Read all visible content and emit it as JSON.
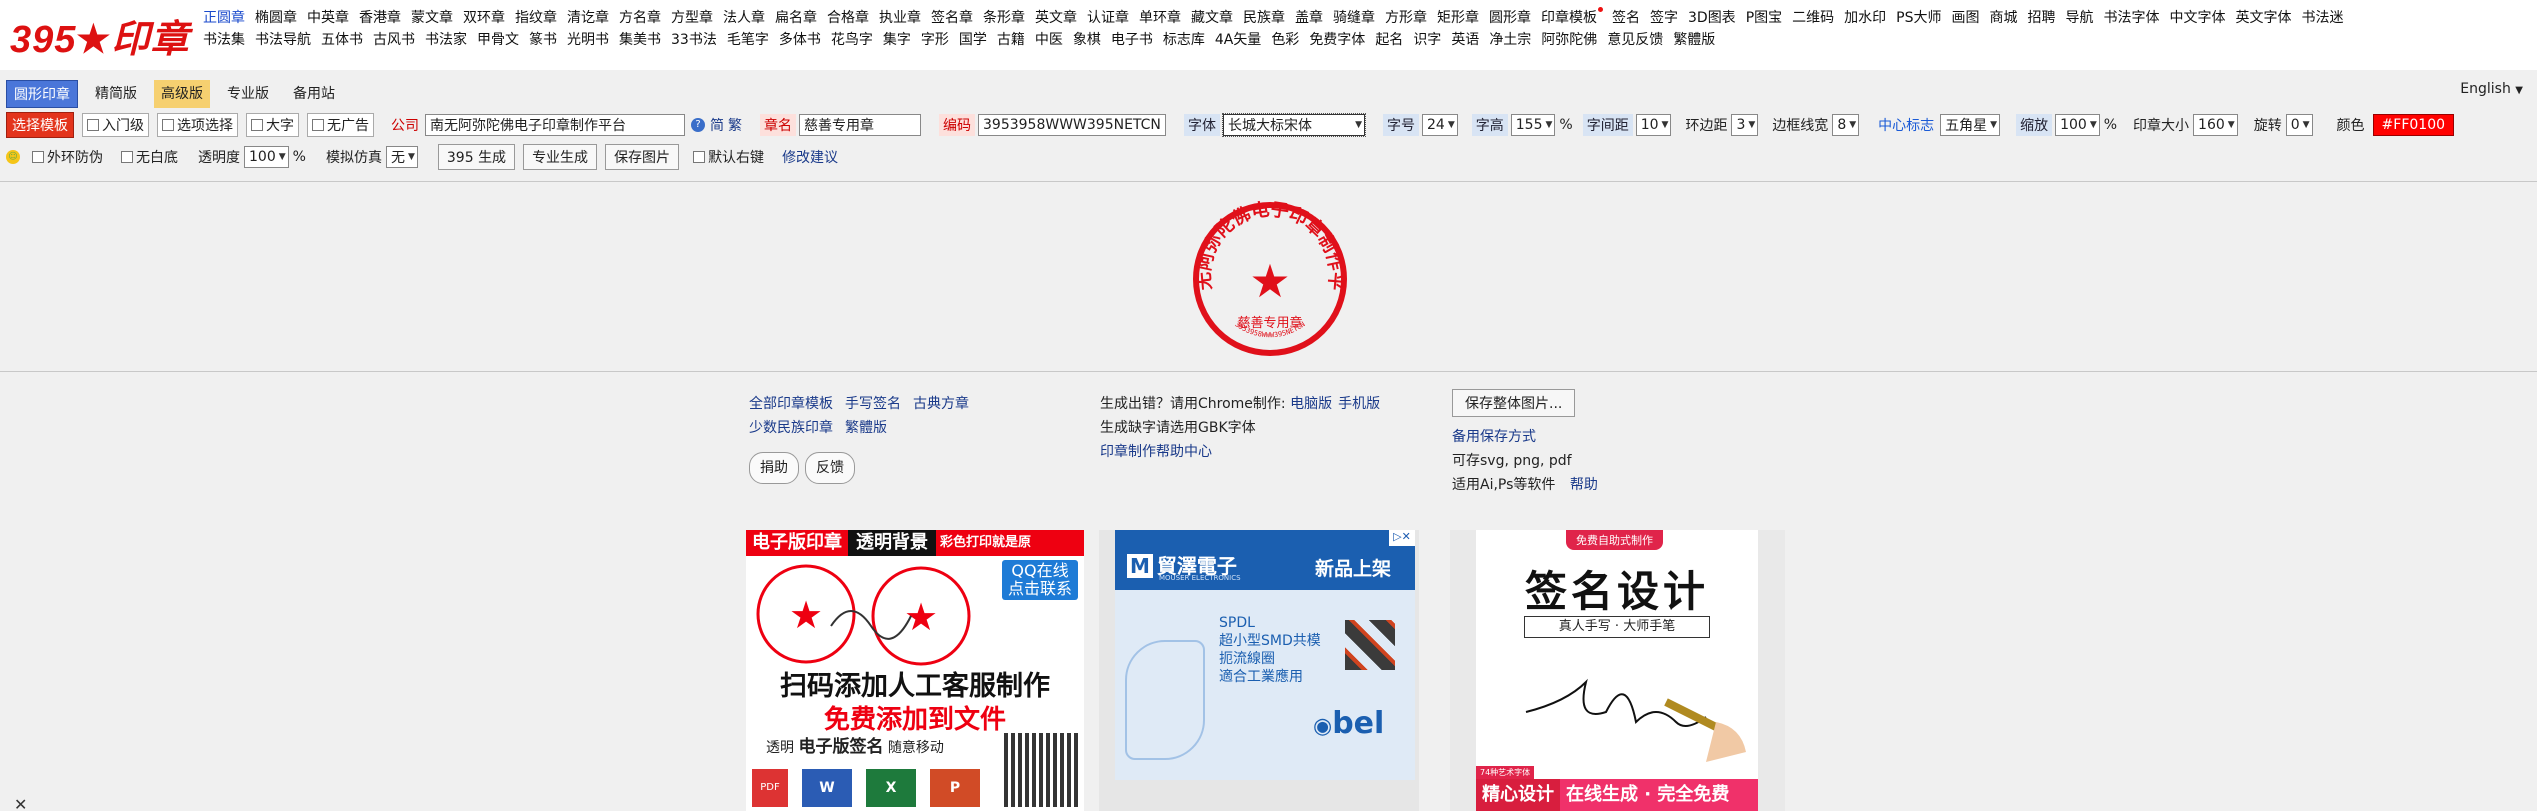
{
  "logo": {
    "text_left": "395",
    "star": "★",
    "text_right": "印章"
  },
  "nav_row1": [
    "正圆章",
    "椭圆章",
    "中英章",
    "香港章",
    "蒙文章",
    "双环章",
    "指纹章",
    "清讫章",
    "方名章",
    "方型章",
    "法人章",
    "扁名章",
    "合格章",
    "执业章",
    "签名章",
    "条形章",
    "英文章",
    "认证章",
    "单环章",
    "藏文章",
    "民族章",
    "盖章",
    "骑缝章",
    "方形章",
    "矩形章",
    "圆形章",
    "印章模板",
    "签名",
    "签字",
    "3D图表",
    "P图宝",
    "二维码",
    "加水印",
    "PS大师",
    "画图",
    "商城",
    "招聘",
    "导航",
    "书法字体",
    "中文字体",
    "英文字体",
    "书法迷"
  ],
  "nav_row2": [
    "书法集",
    "书法导航",
    "五体书",
    "古风书",
    "书法家",
    "甲骨文",
    "篆书",
    "光明书",
    "集美书",
    "33书法",
    "毛笔字",
    "多体书",
    "花鸟字",
    "集字",
    "字形",
    "国学",
    "古籍",
    "中医",
    "象棋",
    "电子书",
    "标志库",
    "4A矢量",
    "色彩",
    "免费字体",
    "起名",
    "识字",
    "英语",
    "净土宗",
    "阿弥陀佛",
    "意见反馈",
    "繁體版"
  ],
  "tabs": [
    "圆形印章",
    "精简版",
    "高级版",
    "专业版",
    "备用站"
  ],
  "language": "English",
  "toolbar": {
    "template_btn": "选择模板",
    "beginner": "入门级",
    "option_select": "选项选择",
    "big_char": "大字",
    "no_ads": "无广告",
    "company_label": "公司",
    "company_value": "南无阿弥陀佛电子印章制作平台",
    "simp": "简",
    "trad": "繁",
    "seal_name_label": "章名",
    "seal_name_value": "慈善专用章",
    "code_label": "编码",
    "code_value": "3953958WWW395NETCN",
    "font_label": "字体",
    "font_value": "长城大标宋体",
    "size_label": "字号",
    "size_value": "24",
    "height_label": "字高",
    "height_value": "155",
    "percent": "%",
    "spacing_label": "字间距",
    "spacing_value": "10",
    "ring_margin_label": "环边距",
    "ring_margin_value": "3",
    "border_width_label": "边框线宽",
    "border_width_value": "8",
    "center_mark_label": "中心标志",
    "center_mark_value": "五角星",
    "zoom_label": "缩放",
    "zoom_value": "100",
    "stamp_size_label": "印章大小",
    "stamp_size_value": "160",
    "rotate_label": "旋转",
    "rotate_value": "0",
    "color_label": "颜色",
    "color_value": "#FF0100",
    "outer_ring": "外环防伪",
    "no_white": "无白底",
    "opacity_label": "透明度",
    "opacity_value": "100",
    "simulate_label": "模拟仿真",
    "simulate_value": "无",
    "gen395": "395 生成",
    "pro_gen": "专业生成",
    "save_img": "保存图片",
    "default_right": "默认右键",
    "suggest": "修改建议"
  },
  "stamp": {
    "color": "#e0101a",
    "top_text": "南无阿弥陀佛电子印章制作平台",
    "bottom_text": "慈善专用章",
    "code_text": "3953958WWW395NETCN",
    "star": "★"
  },
  "links_left": {
    "row1": [
      "全部印章模板",
      "手写签名",
      "古典方章"
    ],
    "row2": [
      "少数民族印章",
      "繁體版"
    ],
    "help": "捐助",
    "feedback": "反馈"
  },
  "links_mid": {
    "line1_text": "生成出错？请用Chrome制作:",
    "line1_links": [
      "电脑版",
      "手机版"
    ],
    "line2": "生成缺字请选用GBK字体",
    "line3": "印章制作帮助中心"
  },
  "links_right": {
    "save_all": "保存整体图片...",
    "backup": "备用保存方式",
    "formats": "可存svg, png, pdf",
    "software": "适用Ai,Ps等软件",
    "help": "帮助"
  },
  "ad1": {
    "banner_a": "电子版印章",
    "banner_b": "透明背景",
    "banner_c": "彩色打印就是原",
    "qq1": "QQ在线",
    "qq2": "点击联系",
    "line1": "扫码添加人工客服制作",
    "line2": "免费添加到文件",
    "line3_a": "透明",
    "line3_b": "电子版签名",
    "line3_c": "随意移动"
  },
  "ad2": {
    "brand": "貿澤電子",
    "brand_sub": "MOUSER ELECTRONICS",
    "new": "新品上架",
    "spdl": "SPDL",
    "desc1": "超小型SMD共模",
    "desc2": "扼流線圈",
    "desc3": "適合工業應用",
    "bel": "bel"
  },
  "ad3": {
    "badge": "免费自助式制作",
    "title": "签名设计",
    "subtitle": "真人手写 · 大师手笔",
    "footer_left": "精心设计",
    "footer_right": "在线生成 · 完全免费",
    "tag": "74种艺术字体"
  },
  "close": "✕"
}
